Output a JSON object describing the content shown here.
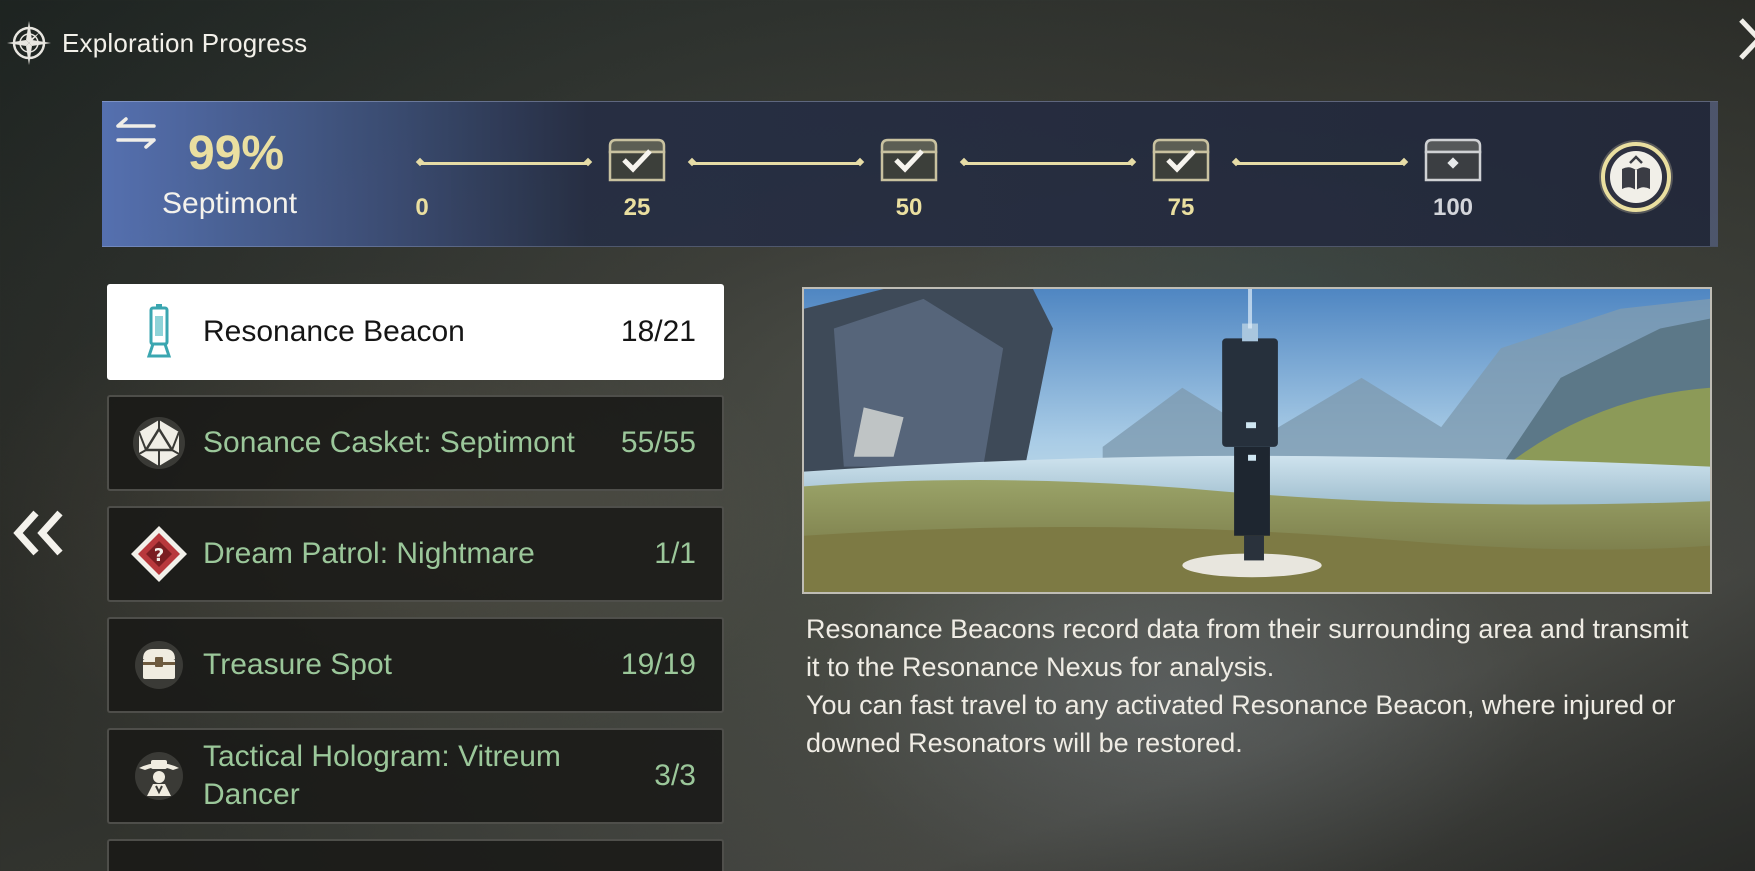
{
  "header": {
    "title": "Exploration Progress",
    "icon": "compass-icon"
  },
  "progress": {
    "percent_text": "99%",
    "percent_value": 99,
    "region": "Septimont",
    "milestones": [
      {
        "label": "0",
        "claimed": null
      },
      {
        "label": "25",
        "claimed": true
      },
      {
        "label": "50",
        "claimed": true
      },
      {
        "label": "75",
        "claimed": true
      },
      {
        "label": "100",
        "claimed": false
      }
    ],
    "accent_color": "#eadfa0"
  },
  "categories": [
    {
      "icon": "beacon-icon",
      "label": "Resonance Beacon",
      "count": "18/21",
      "active": true
    },
    {
      "icon": "d20-icon",
      "label": "Sonance Casket: Septimont",
      "count": "55/55",
      "active": false
    },
    {
      "icon": "dream-patrol-icon",
      "label": "Dream Patrol: Nightmare",
      "count": "1/1",
      "active": false
    },
    {
      "icon": "treasure-chest-icon",
      "label": "Treasure Spot",
      "count": "19/19",
      "active": false
    },
    {
      "icon": "hologram-dancer-icon",
      "label": "Tactical Hologram: Vitreum Dancer",
      "count": "3/3",
      "active": false
    }
  ],
  "description": {
    "line1": "Resonance Beacons record data from their surrounding area and transmit it to the Resonance Nexus for analysis.",
    "line2": "You can fast travel to any activated Resonance Beacon, where injured or downed Resonators will be restored."
  },
  "colors": {
    "completed_text": "#9bc79a",
    "active_bg": "#ffffff"
  }
}
